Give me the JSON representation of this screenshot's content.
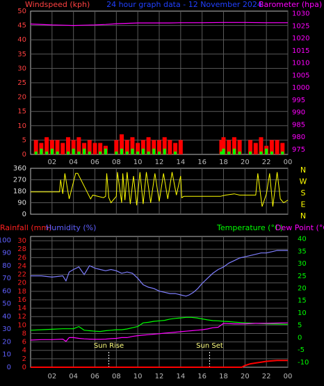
{
  "header": {
    "left_title": "Windspeed (kph)",
    "center_title": "24 hour graph data - 12 November 2024",
    "right_title": "Barometer (hpa)"
  },
  "colors": {
    "wind": "#ff0000",
    "gust": "#00ff00",
    "barometer": "#ff00ff",
    "direction": "#ffff00",
    "rain": "#ff0000",
    "humidity": "#7f7fff",
    "temperature": "#00ff00",
    "dewpoint": "#ff00ff",
    "axis_left_top": "#ff4040",
    "axis_right_top": "#ff00ff",
    "title_blue": "#2040ff",
    "rain_axis": "#ff2020",
    "humidity_axis": "#6060ff",
    "temp_axis": "#00ff00"
  },
  "time_ticks": [
    "02",
    "04",
    "06",
    "08",
    "10",
    "12",
    "14",
    "16",
    "18",
    "20",
    "22",
    "00"
  ],
  "direction_labels": [
    "N",
    "W",
    "S",
    "E",
    "N"
  ],
  "bottom_labels": {
    "rainfall": "Rainfall (mm)",
    "humidity": "Humidity (%)",
    "temperature": "Temperature (°C)",
    "dewpoint": "Dew Point (°C)",
    "sunrise": "Sun Rise",
    "sunset": "Sun Set"
  },
  "chart_data": [
    {
      "type": "line",
      "title": "24 hour graph data - 12 November 2024",
      "x_unit": "hour",
      "xlim": [
        0,
        24
      ],
      "yleft_label": "Windspeed (kph)",
      "yleft_ticks": [
        0,
        5,
        10,
        15,
        20,
        25,
        30,
        35,
        40,
        45,
        50
      ],
      "ylim_left": [
        0,
        50
      ],
      "yright_label": "Barometer (hpa)",
      "yright_ticks": [
        975,
        980,
        985,
        990,
        995,
        1000,
        1005,
        1010,
        1015,
        1020,
        1025,
        1030
      ],
      "ylim_right": [
        973,
        1031
      ],
      "series": [
        {
          "name": "Barometer (hpa)",
          "axis": "right",
          "x": [
            0,
            2,
            3,
            4,
            5,
            6,
            7,
            8,
            10,
            12,
            13,
            14,
            16,
            18,
            20,
            22,
            24
          ],
          "y": [
            1025.8,
            1025.4,
            1025.3,
            1025.2,
            1025.3,
            1025.4,
            1025.6,
            1025.9,
            1026.2,
            1026.2,
            1026.2,
            1026.3,
            1026.3,
            1026.4,
            1026.4,
            1026.3,
            1026.3
          ]
        },
        {
          "name": "Windspeed (kph)",
          "axis": "left",
          "x": [
            0.5,
            1,
            1.5,
            2,
            2.5,
            3,
            3.5,
            4,
            4.5,
            5,
            5.5,
            6,
            6.5,
            7,
            7.5,
            8,
            8.5,
            9,
            9.5,
            10,
            10.5,
            11,
            11.5,
            12,
            12.5,
            13,
            13.5,
            14,
            17.8,
            18,
            18.5,
            19,
            19.5,
            20,
            20.5,
            21,
            21.5,
            22,
            22.5,
            23,
            23.5
          ],
          "y": [
            5,
            4,
            6,
            5,
            5,
            4,
            6,
            5,
            6,
            4,
            5,
            4,
            4,
            3,
            0,
            5,
            7,
            5,
            6,
            4,
            5,
            6,
            5,
            5,
            6,
            5,
            4,
            5,
            5,
            6,
            5,
            6,
            5,
            0,
            5,
            4,
            6,
            3,
            5,
            5,
            4
          ]
        },
        {
          "name": "Gust",
          "axis": "left",
          "x": [
            0.5,
            1,
            1.5,
            2,
            2.5,
            3,
            3.5,
            4,
            4.5,
            5,
            5.5,
            6,
            6.5,
            7,
            7.5,
            8,
            8.5,
            9,
            9.5,
            10,
            10.5,
            11,
            11.5,
            12,
            12.5,
            13,
            13.5,
            14,
            17.8,
            18,
            18.5,
            19,
            19.5,
            20,
            20.5,
            21,
            21.5,
            22,
            22.5,
            23,
            23.5
          ],
          "y": [
            1,
            2,
            1,
            2,
            1,
            0,
            1,
            2,
            1,
            2,
            1,
            0,
            1,
            2,
            0,
            1,
            2,
            1,
            2,
            1,
            2,
            1,
            2,
            1,
            2,
            0,
            1,
            0,
            1,
            2,
            1,
            2,
            1,
            0,
            1,
            0,
            1,
            2,
            1,
            0,
            1
          ]
        }
      ]
    },
    {
      "type": "line",
      "title": "",
      "x_unit": "hour",
      "xlim": [
        0,
        24
      ],
      "yleft_ticks": [
        0,
        90,
        180,
        270,
        360
      ],
      "ylim": [
        0,
        360
      ],
      "right_labels": [
        "N",
        "W",
        "S",
        "E",
        "N"
      ],
      "series": [
        {
          "name": "Wind Direction",
          "x": [
            0,
            2.7,
            2.8,
            3,
            3.2,
            3.6,
            4.2,
            4.4,
            5.6,
            5.8,
            6.8,
            7,
            7.1,
            7.3,
            7.5,
            8,
            8.1,
            8.5,
            8.6,
            8.8,
            9,
            9.3,
            9.6,
            9.9,
            10.2,
            10.5,
            10.8,
            11.2,
            11.6,
            12,
            12.4,
            12.8,
            13.2,
            13.6,
            14,
            14.1,
            14.3,
            17.7,
            18.2,
            19,
            19.5,
            20.2,
            21,
            21.2,
            21.6,
            22,
            22.3,
            22.6,
            23,
            23.3,
            23.6,
            24
          ],
          "y": [
            175,
            175,
            270,
            160,
            320,
            120,
            320,
            320,
            120,
            150,
            130,
            140,
            320,
            130,
            90,
            140,
            330,
            90,
            320,
            110,
            330,
            80,
            300,
            70,
            330,
            80,
            330,
            90,
            320,
            100,
            320,
            120,
            330,
            150,
            300,
            130,
            140,
            140,
            150,
            160,
            150,
            150,
            150,
            320,
            60,
            160,
            320,
            60,
            330,
            120,
            90,
            110
          ]
        }
      ]
    },
    {
      "type": "line",
      "title": "",
      "x_unit": "hour",
      "xlim": [
        0,
        24
      ],
      "yleft_rain_label": "Rainfall (mm)",
      "yleft_rain_ticks": [
        0,
        2,
        4,
        6,
        8,
        10,
        12,
        14,
        16,
        18,
        20,
        22,
        24,
        26,
        28,
        30
      ],
      "yleft_humidity_label": "Humidity (%)",
      "yleft_humidity_ticks": [
        0,
        10,
        20,
        30,
        40,
        50,
        60,
        70,
        80,
        90,
        100
      ],
      "yright_label": "Temperature (°C)",
      "yright2_label": "Dew Point (°C)",
      "yright_ticks": [
        -10,
        -5,
        0,
        5,
        10,
        15,
        20,
        25,
        30,
        35,
        40
      ],
      "annotations": [
        {
          "text": "Sun Rise",
          "x": 7.3
        },
        {
          "text": "Sun Set",
          "x": 16.7
        }
      ],
      "series": [
        {
          "name": "Humidity (%)",
          "axis": "humidity",
          "x": [
            0,
            1,
            2,
            3,
            3.3,
            3.6,
            4,
            4.5,
            5,
            5.5,
            6,
            6.5,
            7,
            7.5,
            8,
            8.5,
            9,
            9.5,
            10,
            10.5,
            11,
            11.5,
            12,
            12.5,
            13,
            13.5,
            14,
            14.5,
            14.8,
            15.2,
            15.6,
            16,
            16.5,
            17,
            17.5,
            18,
            18.5,
            19,
            19.5,
            20,
            20.5,
            21,
            21.5,
            22,
            22.5,
            23,
            23.5,
            24
          ],
          "y": [
            72,
            72,
            71,
            72,
            68,
            75,
            77,
            79,
            73,
            80,
            78,
            77,
            76,
            77,
            76,
            74,
            75,
            74,
            70,
            65,
            63,
            62,
            60,
            59,
            58,
            58,
            57,
            56,
            57,
            59,
            62,
            66,
            70,
            74,
            77,
            79,
            82,
            84,
            86,
            87,
            88,
            89,
            90,
            90,
            91,
            92,
            92,
            92
          ]
        },
        {
          "name": "Temperature (°C)",
          "axis": "temp",
          "x": [
            0,
            1,
            2,
            3,
            4,
            4.5,
            5,
            5.5,
            6,
            6.5,
            7,
            7.5,
            8,
            8.5,
            9,
            9.5,
            10,
            10.5,
            11,
            11.5,
            12,
            12.5,
            13,
            13.5,
            14,
            14.5,
            15,
            15.5,
            16,
            16.5,
            17,
            17.5,
            18,
            18.5,
            19,
            20,
            21,
            22,
            23,
            24
          ],
          "y": [
            3,
            3.2,
            3.4,
            3.6,
            3.6,
            4.5,
            3,
            2.8,
            2.6,
            2.5,
            2.8,
            3,
            3.2,
            3.2,
            3.5,
            4,
            4.5,
            6,
            6.2,
            6.6,
            6.8,
            7,
            7.5,
            7.8,
            8,
            8.2,
            8.2,
            8,
            7.6,
            7.2,
            6.9,
            6.8,
            6.6,
            6.5,
            6.3,
            6,
            5.8,
            5.6,
            5.5,
            5.4
          ]
        },
        {
          "name": "Dew Point (°C)",
          "axis": "temp",
          "x": [
            0,
            1,
            2,
            3,
            3.3,
            3.6,
            4,
            4.5,
            5,
            5.5,
            6,
            6.5,
            7,
            7.5,
            8,
            8.5,
            9,
            9.5,
            10,
            10.5,
            11,
            11.5,
            12,
            12.5,
            13,
            13.5,
            14,
            14.5,
            15,
            15.5,
            16,
            16.5,
            17,
            17.5,
            18,
            19,
            20,
            21,
            22,
            23,
            24
          ],
          "y": [
            -1,
            -0.8,
            -0.8,
            -0.6,
            -1.5,
            0,
            0,
            -0.3,
            -0.5,
            -0.6,
            -0.7,
            -0.7,
            -0.6,
            -0.4,
            -0.3,
            0,
            0,
            0.5,
            0.8,
            1,
            1.2,
            1.4,
            1.6,
            1.8,
            2,
            2.2,
            2.4,
            2.6,
            2.8,
            3,
            3.2,
            3.5,
            4,
            4.2,
            5.8,
            5.6,
            5.6,
            5.8,
            5.8,
            5.9,
            6
          ]
        },
        {
          "name": "Rainfall (mm)",
          "axis": "rain",
          "x": [
            0,
            19,
            19.7,
            20,
            20.5,
            21,
            21.5,
            22,
            22.5,
            23,
            23.5,
            24
          ],
          "y": [
            0,
            0,
            0,
            0.4,
            0.8,
            1.0,
            1.2,
            1.4,
            1.5,
            1.6,
            1.6,
            1.6
          ]
        }
      ]
    }
  ]
}
